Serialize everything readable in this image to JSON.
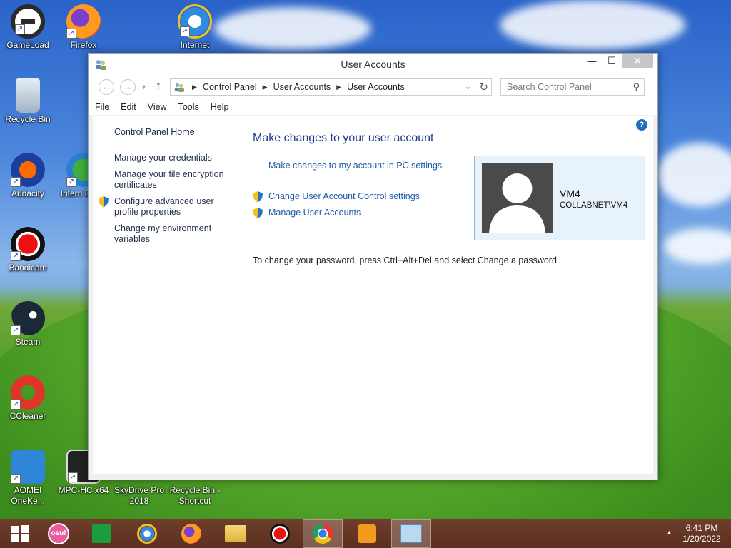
{
  "desktop": {
    "icons": [
      {
        "label": "GameLoad"
      },
      {
        "label": "Firefox"
      },
      {
        "label": "Internet"
      },
      {
        "label": "Recycle Bin"
      },
      {
        "label": "Audacity"
      },
      {
        "label": "Intern Down"
      },
      {
        "label": "Bandicam"
      },
      {
        "label": "Steam"
      },
      {
        "label": "CCleaner"
      },
      {
        "label": "AOMEI OneKe..."
      },
      {
        "label": "MPC-HC x64"
      },
      {
        "label": "SkyDrive Pro 2018"
      },
      {
        "label": "Recycle Bin - Shortcut"
      }
    ]
  },
  "window": {
    "title": "User Accounts",
    "controls": {
      "minimize": "—",
      "maximize": "☐",
      "close": "✕"
    },
    "address": {
      "crumbs": [
        "Control Panel",
        "User Accounts",
        "User Accounts"
      ]
    },
    "search": {
      "placeholder": "Search Control Panel"
    },
    "menu": [
      "File",
      "Edit",
      "View",
      "Tools",
      "Help"
    ],
    "sidebar": {
      "home": "Control Panel Home",
      "links": [
        "Manage your credentials",
        "Manage your file encryption certificates",
        "Configure advanced user profile properties",
        "Change my environment variables"
      ]
    },
    "main": {
      "heading": "Make changes to your user account",
      "pc_settings_link": "Make changes to my account in PC settings",
      "uac_link": "Change User Account Control settings",
      "manage_link": "Manage User Accounts",
      "password_note": "To change your password, press Ctrl+Alt+Del and select Change a password."
    },
    "user": {
      "name": "VM4",
      "domain": "COLLABNET\\VM4"
    }
  },
  "taskbar": {
    "osu_label": "osu!",
    "clock_time": "6:41 PM",
    "clock_date": "1/20/2022"
  },
  "colors": {
    "link": "#1f5ba8",
    "heading": "#1e3a8a",
    "card_bg": "#e7f2fb",
    "taskbar": "#5c2f20"
  }
}
